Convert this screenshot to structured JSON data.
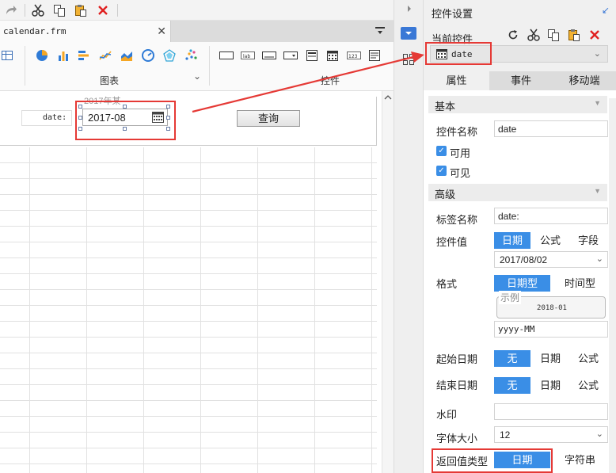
{
  "toolbar": {
    "icons": [
      "redo-icon",
      "cut-icon",
      "copy-icon",
      "paste-icon",
      "delete-icon"
    ]
  },
  "file_tab": {
    "label": "calendar.frm",
    "close": "✕"
  },
  "ribbon": {
    "chart_group_label": "图表",
    "widget_group_label": "控件",
    "expand": "⌄"
  },
  "form": {
    "label_text": "date:",
    "watermark": "2017年某",
    "date_value": "2017-08",
    "query_button": "查询"
  },
  "panel": {
    "title": "控件设置",
    "collapse": "↙",
    "current_widget_label": "当前控件",
    "current_widget_name": "date",
    "tabs": [
      "属性",
      "事件",
      "移动端"
    ],
    "sections": {
      "basic": "基本",
      "advanced": "高级"
    },
    "widget_name_label": "控件名称",
    "widget_name_value": "date",
    "enabled_label": "可用",
    "visible_label": "可见",
    "tag_name_label": "标签名称",
    "tag_name_value": "date:",
    "widget_value_label": "控件值",
    "value_types": [
      "日期",
      "公式",
      "字段"
    ],
    "widget_value_date": "2017/08/02",
    "format_label": "格式",
    "format_types": [
      "日期型",
      "时间型"
    ],
    "example_legend": "示例",
    "example_value": "2018-01",
    "format_pattern": "yyyy-MM",
    "start_date_label": "起始日期",
    "end_date_label": "结束日期",
    "date_opts": [
      "无",
      "日期",
      "公式"
    ],
    "watermark_label": "水印",
    "font_size_label": "字体大小",
    "font_size_value": "12",
    "return_type_label": "返回值类型",
    "return_types": [
      "日期",
      "字符串"
    ]
  },
  "colors": {
    "accent": "#3a8ee6",
    "highlight": "#e53935"
  }
}
